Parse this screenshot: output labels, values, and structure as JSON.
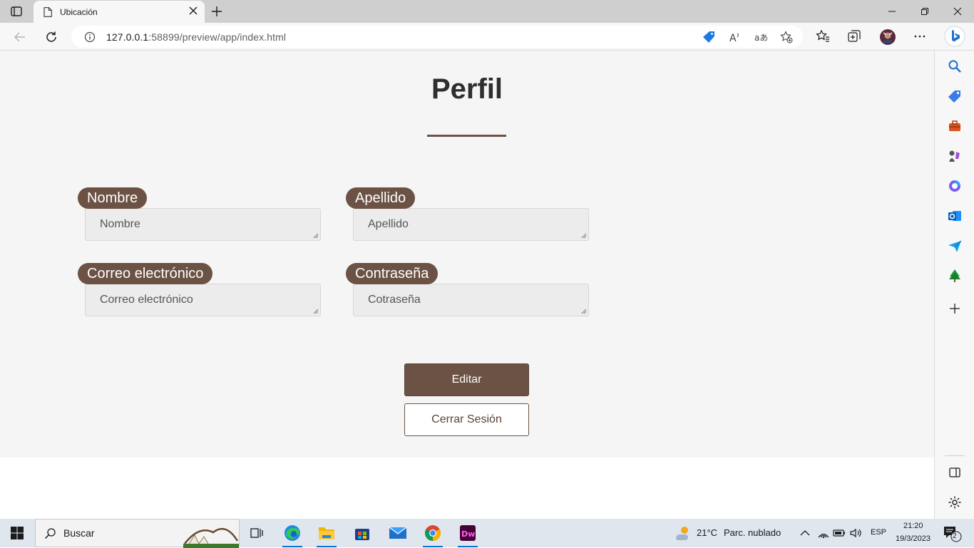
{
  "browser": {
    "tab_title": "Ubicación",
    "url_host": "127.0.0.1",
    "url_rest": ":58899/preview/app/index.html"
  },
  "page": {
    "title": "Perfil",
    "fields": {
      "nombre": {
        "label": "Nombre",
        "placeholder": "Nombre"
      },
      "apellido": {
        "label": "Apellido",
        "placeholder": "Apellido"
      },
      "correo": {
        "label": "Correo electrónico",
        "placeholder": "Correo electrónico"
      },
      "contrasena": {
        "label": "Contraseña",
        "placeholder": "Cotraseña"
      }
    },
    "edit_label": "Editar",
    "logout_label": "Cerrar Sesión",
    "accent_color": "#6b5244"
  },
  "taskbar": {
    "search_label": "Buscar",
    "weather_temp": "21°C",
    "weather_desc": "Parc. nublado",
    "language": "ESP",
    "time": "21:20",
    "date": "19/3/2023",
    "notification_count": "2"
  }
}
